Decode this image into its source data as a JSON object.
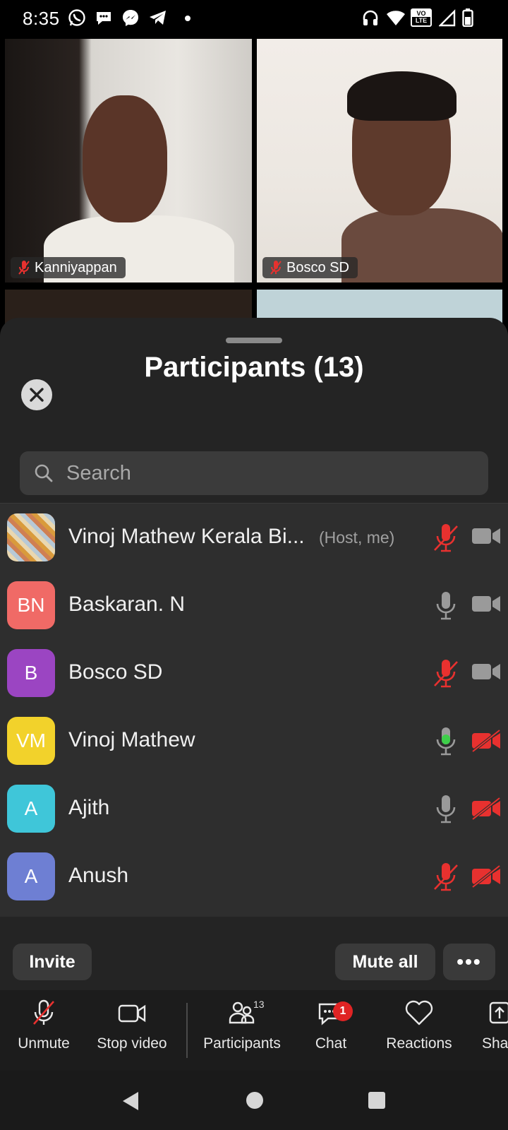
{
  "status_bar": {
    "time": "8:35",
    "icons": [
      "whatsapp-icon",
      "messages-icon",
      "messenger-icon",
      "telegram-icon",
      "dot-icon",
      "headphones-icon",
      "wifi-icon",
      "volte-icon",
      "signal-icon",
      "battery-icon"
    ],
    "volte_label_top": "VO",
    "volte_label_bottom": "LTE"
  },
  "video_tiles": [
    {
      "name": "Kanniyappan",
      "muted": true
    },
    {
      "name": "Bosco SD",
      "muted": true
    }
  ],
  "panel": {
    "title": "Participants (13)",
    "search_placeholder": "Search"
  },
  "participants": [
    {
      "name": "Vinoj Mathew Kerala Bi...",
      "tag": "(Host, me)",
      "initials": "",
      "avatar_color": "#c9a46a",
      "mic": "muted",
      "video": "on"
    },
    {
      "name": "Baskaran. N",
      "tag": "",
      "initials": "BN",
      "avatar_color": "#f06a66",
      "mic": "on",
      "video": "on"
    },
    {
      "name": "Bosco SD",
      "tag": "",
      "initials": "B",
      "avatar_color": "#9b45c2",
      "mic": "muted",
      "video": "on"
    },
    {
      "name": "Vinoj Mathew",
      "tag": "",
      "initials": "VM",
      "avatar_color": "#f2d22b",
      "mic": "speaking",
      "video": "off"
    },
    {
      "name": "Ajith",
      "tag": "",
      "initials": "A",
      "avatar_color": "#3fc6d9",
      "mic": "on",
      "video": "off"
    },
    {
      "name": "Anush",
      "tag": "",
      "initials": "A",
      "avatar_color": "#6e7fd3",
      "mic": "muted",
      "video": "off"
    }
  ],
  "actions": {
    "invite": "Invite",
    "mute_all": "Mute all",
    "more": "•••"
  },
  "toolbar": {
    "unmute": "Unmute",
    "stop_video": "Stop video",
    "participants": "Participants",
    "participants_count": "13",
    "chat": "Chat",
    "chat_badge": "1",
    "reactions": "Reactions",
    "share": "Sha"
  },
  "colors": {
    "muted_red": "#e8312f",
    "speaking_green": "#3ecf4a",
    "icon_gray": "#9a9a9a"
  }
}
